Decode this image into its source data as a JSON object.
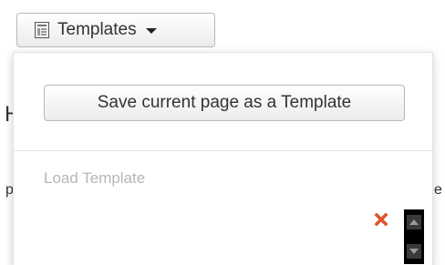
{
  "background": {
    "heading_fragment": "H",
    "left_text_fragment": "p",
    "right_text_fragment": "e"
  },
  "toolbar": {
    "templates_label": "Templates",
    "templates_icon": "template-icon",
    "caret_icon": "caret-down-icon"
  },
  "dropdown": {
    "save_label": "Save current page as a Template",
    "load_label": "Load Template",
    "delete_icon": "red-x-icon",
    "scroll_up_icon": "scroll-up-icon",
    "scroll_down_icon": "scroll-down-icon"
  },
  "colors": {
    "delete_red": "#e8552b",
    "scroll_bg": "#000000",
    "muted_text": "#b6b6b6"
  }
}
